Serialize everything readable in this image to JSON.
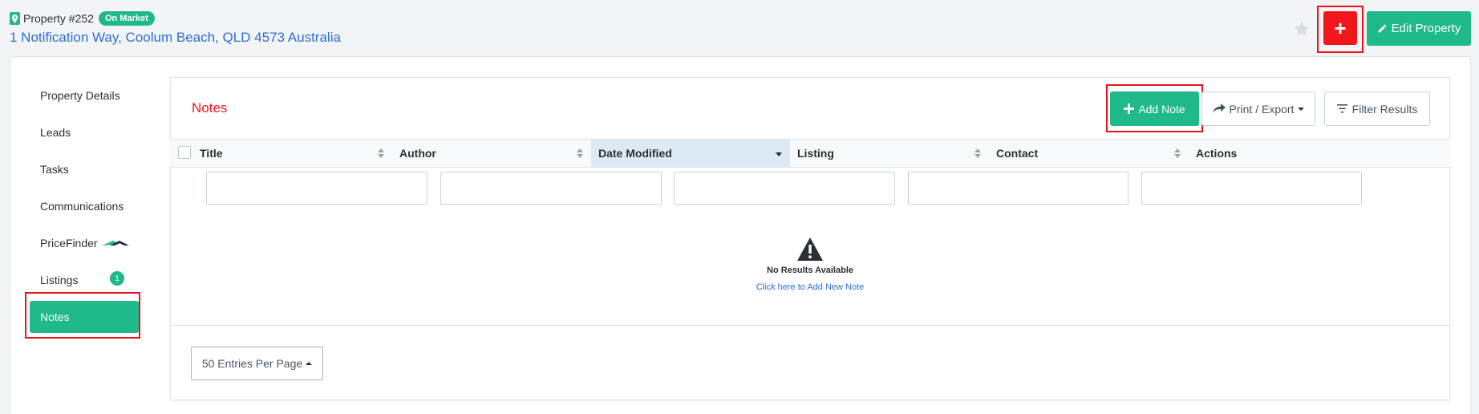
{
  "header": {
    "property_label": "Property #252",
    "status_badge": "On Market",
    "address": "1 Notification Way, Coolum Beach, QLD 4573 Australia",
    "add_button": "+",
    "edit_button": "Edit Property"
  },
  "sidebar": {
    "items": [
      {
        "label": "Property Details"
      },
      {
        "label": "Leads"
      },
      {
        "label": "Tasks"
      },
      {
        "label": "Communications"
      },
      {
        "label": "PriceFinder"
      },
      {
        "label": "Listings",
        "badge": "1"
      },
      {
        "label": "Notes",
        "active": true
      }
    ]
  },
  "notes": {
    "title": "Notes",
    "add_note": "Add Note",
    "print_export": "Print / Export",
    "filter_results": "Filter Results",
    "columns": [
      "Title",
      "Author",
      "Date Modified",
      "Listing",
      "Contact",
      "Actions"
    ],
    "sorted_column": "Date Modified",
    "filter_values": [
      "",
      "",
      "",
      "",
      ""
    ],
    "empty_message": "No Results Available",
    "empty_link": "Click here to Add New Note",
    "entries_per_page": "50 Entries Per Page"
  },
  "colors": {
    "accent_green": "#1fb98a",
    "alert_red": "#f1151c",
    "link_blue": "#2d6fd2"
  }
}
